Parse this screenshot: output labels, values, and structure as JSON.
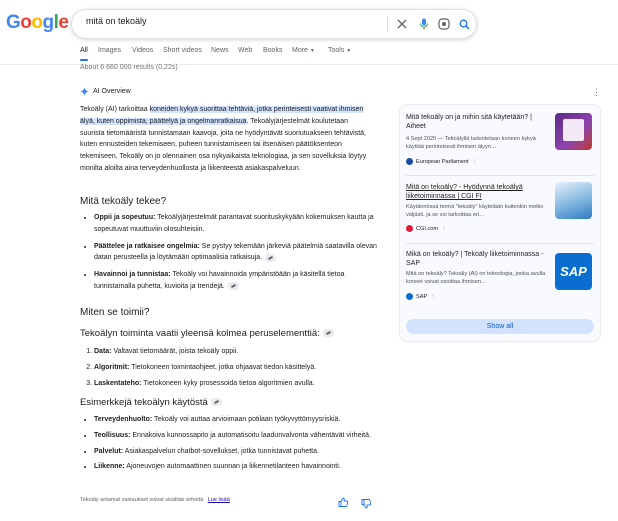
{
  "header": {
    "logo_letters": [
      {
        "ch": "G",
        "color": "#4285f4"
      },
      {
        "ch": "o",
        "color": "#ea4335"
      },
      {
        "ch": "o",
        "color": "#fbbc05"
      },
      {
        "ch": "g",
        "color": "#4285f4"
      },
      {
        "ch": "l",
        "color": "#34a853"
      },
      {
        "ch": "e",
        "color": "#ea4335"
      }
    ],
    "query": "mitä on tekoäly"
  },
  "tabs": [
    "All",
    "Images",
    "Videos",
    "Short videos",
    "News",
    "Web",
    "Books",
    "More",
    "Tools"
  ],
  "results_count": "About 6 660 000 results (0,22s)",
  "ai_overview": {
    "label": "AI Overview",
    "intro_plain_1": "Tekoäly (AI) tarkoittaa ",
    "intro_highlight": "koneiden kykyä suorittaa tehtäviä, jotka perinteisesti vaativat ihmisen älyä, kuten oppimista, päättelyä ja ongelmanratkaisua",
    "intro_plain_2": ". Tekoälyjärjestelmät koulutetaan suurista tietomääristä tunnistamaan kaavoja, joita ne hyödyntävät suoriutuakseen tehtävistä, kuten ennusteiden tekemiseen, puheen tunnistamiseen tai itsenäisen päätöksenteon tekemiseen. Tekoäly on jo olennainen osa nykyaikaista teknologiaa, ja sen sovelluksia löytyy monilta aloilta aina terveydenhuollosta ja liikenteestä asiakaspalveluun.",
    "h_what": "Mitä tekoäly tekee?",
    "what_items": [
      {
        "term": "Oppii ja sopeutuu:",
        "text": " Tekoälyjärjestelmät parantavat suorituskykyään kokemuksen kautta ja sopeutuvat muuttuviin olosuhteisiin."
      },
      {
        "term": "Päättelee ja ratkaisee ongelmia:",
        "text": " Se pystyy tekemään järkeviä päätelmiä saatavilla olevan datan perusteella ja löytämään optimaalisia ratkaisuja."
      },
      {
        "term": "Havainnoi ja tunnistaa:",
        "text": " Tekoäly voi havainnoida ympäristöään ja käsitellä tietoa tunnistamalla puhetta, kuvioita ja trendejä."
      }
    ],
    "h_how": "Miten se toimii?",
    "h_three": "Tekoälyn toiminta vaatii yleensä kolmea peruselementtiä:",
    "three_items": [
      {
        "term": "Data:",
        "text": " Valtavat tietomäärät, joista tekoäly oppii."
      },
      {
        "term": "Algoritmit:",
        "text": " Tietokoneen toimintaohjeet, jotka ohjaavat tiedon käsittelyä."
      },
      {
        "term": "Laskentateho:",
        "text": " Tietokoneen kyky prosessoida tietoa algoritmien avulla."
      }
    ],
    "h_examples": "Esimerkkejä tekoälyn käytöstä",
    "example_items": [
      {
        "term": "Terveydenhuolto:",
        "text": " Tekoäly voi auttaa arvioimaan potilaan työkyvyttömyysriskiä."
      },
      {
        "term": "Teollisuus:",
        "text": " Ennakoiva kunnossapito ja automatisoitu laadunvalvonta vähentävät virheitä."
      },
      {
        "term": "Palvelut:",
        "text": " Asiakaspalvelun chatbot-sovellukset, jotka tunnistavat puhetta."
      },
      {
        "term": "Liikenne:",
        "text": " Ajoneuvojen automaattinen suunnan ja liikennetilanteen havainnointi."
      }
    ],
    "footer_note": "Tekoäly antamat vastaukset voivat sisältää virheitä.",
    "footer_link": "Lue lisää"
  },
  "sources": [
    {
      "title": "Mitä tekoäly on ja mihin sitä käytetään? | Aiheet",
      "snippet": "4 Sept 2020 — Tekoälyllä tarkoitetaan koneen kykyä käyttää perinteisesti ihmisen älyyn…",
      "site": "European Parliament",
      "underline": false
    },
    {
      "title": "Mitä on tekoäly? - Hyödynnä tekoälyä liiketoiminnassa | CGI FI",
      "snippet": "Käytännössä termä \"tekoäly\" käytetään kuitenkin melko väljästi, ja se voi tarkoittaa eri…",
      "site": "CGI.com",
      "underline": true
    },
    {
      "title": "Mikä on tekoäly? | Tekoäly liiketoiminnassa - SAP",
      "snippet": "Mitä on tekoäly? Tekoäly (AI) on teknologia, jonka avulla koneet voivat osoittaa ihmisen…",
      "site": "SAP",
      "underline": false,
      "thumb_text": "SAP"
    }
  ],
  "show_all": "Show all",
  "colors": {
    "accent": "#1a73e8",
    "chip": "#d3e3fd",
    "link": "#0b57d0"
  }
}
